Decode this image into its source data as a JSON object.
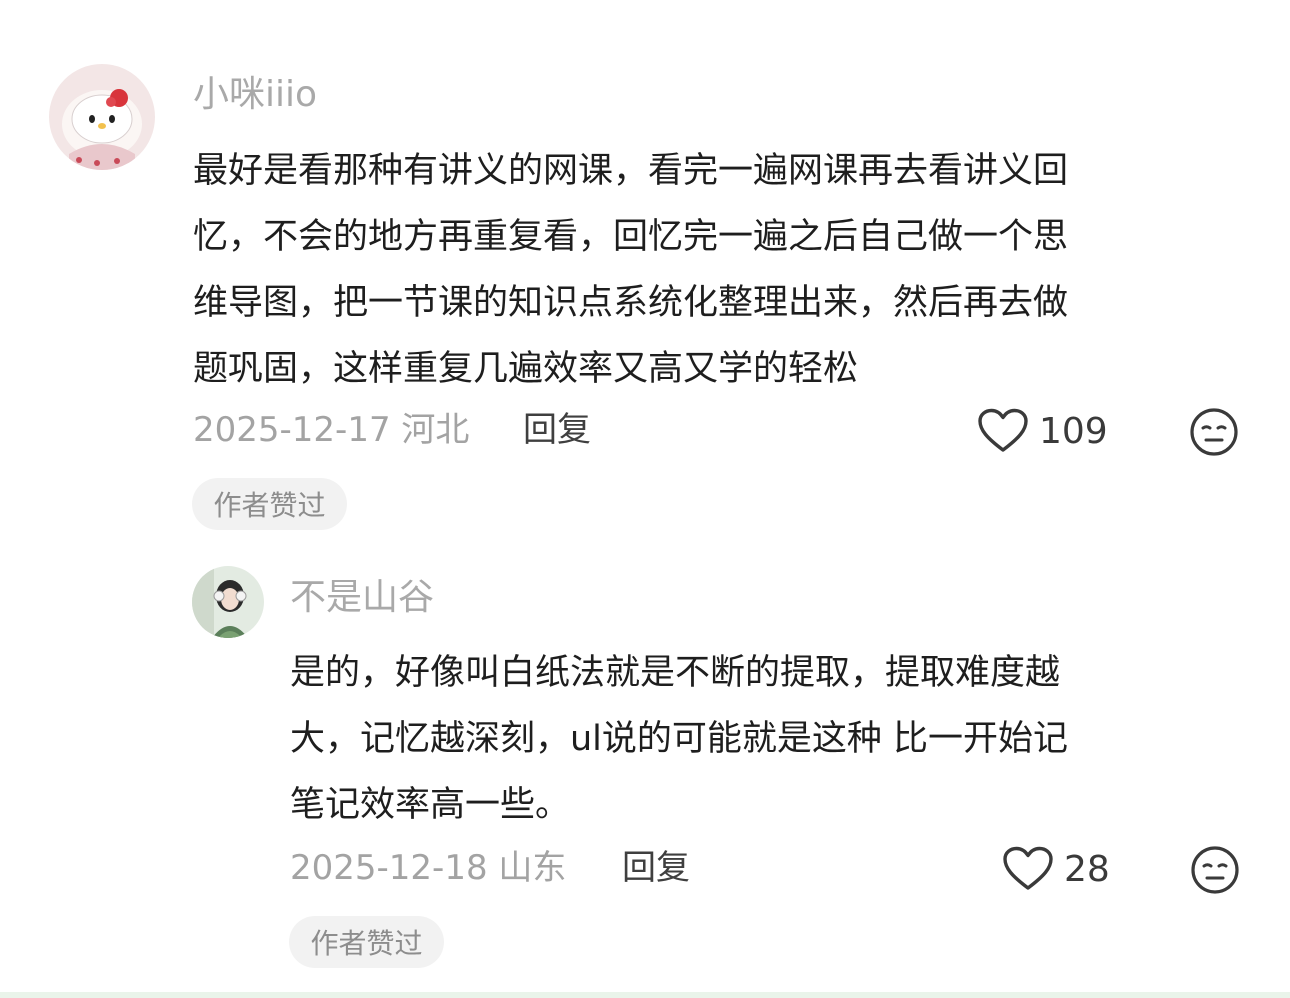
{
  "comments": [
    {
      "username": "小咪iiio",
      "content_lines": [
        "最好是看那种有讲义的网课，看完一遍网课再去看讲义回",
        "忆，不会的地方再重复看，回忆完一遍之后自己做一个思",
        "维导图，把一节课的知识点系统化整理出来，然后再去做",
        "题巩固，这样重复几遍效率又高又学的轻松"
      ],
      "date_location": "2025-12-17 河北",
      "reply_label": "回复",
      "like_count": "109",
      "badge": "作者赞过",
      "like_icon": "heart-outline-icon",
      "dislike_icon": "neutral-face-icon"
    },
    {
      "username": "不是山谷",
      "content_lines": [
        "是的，好像叫白纸法就是不断的提取，提取难度越",
        "大，记忆越深刻，ul说的可能就是这种 比一开始记",
        "笔记效率高一些。"
      ],
      "date_location": "2025-12-18 山东",
      "reply_label": "回复",
      "like_count": "28",
      "badge": "作者赞过",
      "like_icon": "heart-outline-icon",
      "dislike_icon": "neutral-face-icon"
    }
  ],
  "colors": {
    "username": "#a9a9a9",
    "content": "#1e1e1e",
    "meta": "#a3a3a3",
    "icon": "#3a3a3a",
    "badge_bg": "#f2f2f2",
    "badge_text": "#8d8d8d"
  }
}
